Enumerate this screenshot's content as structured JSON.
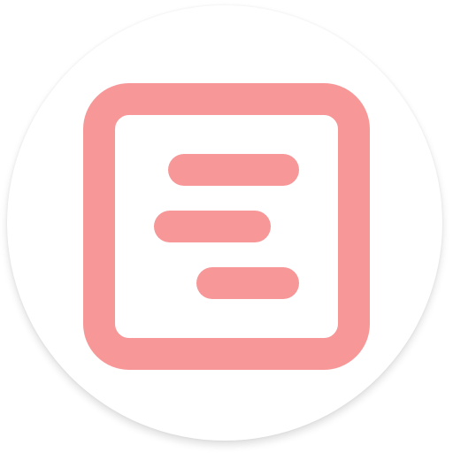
{
  "app_icon": {
    "icon": "text-align-list-icon",
    "accent_color": "#f79797",
    "background_color": "#ffffff"
  }
}
